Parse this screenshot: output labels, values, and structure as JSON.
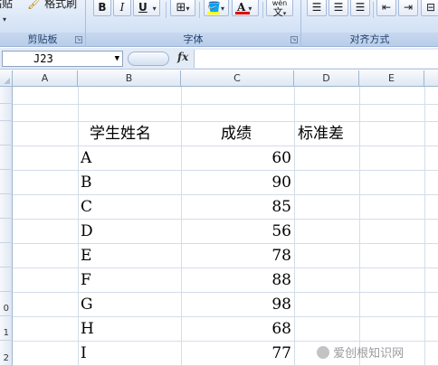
{
  "ribbon": {
    "paste_fragment": "粘贴",
    "format_painter": "格式刷",
    "bold": "B",
    "italic": "I",
    "underline": "U",
    "font_color_letter": "A",
    "phonetic_top": "wén",
    "phonetic_bottom": "文",
    "groups": [
      {
        "label": "剪贴板"
      },
      {
        "label": "字体"
      },
      {
        "label": "对齐方式"
      }
    ]
  },
  "formula_bar": {
    "name_box": "J23",
    "fx": "fx",
    "content": ""
  },
  "grid": {
    "columns": [
      "A",
      "B",
      "C",
      "D",
      "E"
    ],
    "rows": [
      "",
      "",
      "",
      "",
      "",
      "",
      "",
      "",
      "",
      "0",
      "1",
      "2"
    ],
    "headers": {
      "name": "学生姓名",
      "score": "成绩",
      "std": "标准差"
    },
    "students": [
      {
        "name": "A",
        "score": "60"
      },
      {
        "name": "B",
        "score": "90"
      },
      {
        "name": "C",
        "score": "85"
      },
      {
        "name": "D",
        "score": "56"
      },
      {
        "name": "E",
        "score": "78"
      },
      {
        "name": "F",
        "score": "88"
      },
      {
        "name": "G",
        "score": "98"
      },
      {
        "name": "H",
        "score": "68"
      },
      {
        "name": "I",
        "score": "77"
      }
    ]
  },
  "watermark": "爱创根知识网",
  "colors": {
    "ribbon_bg": "#d5e3f6",
    "header_bg": "#dfe7f3",
    "grid_line": "#d4dde9",
    "font_color_bar": "#e00000",
    "fill_color_bar": "#ffff00"
  }
}
